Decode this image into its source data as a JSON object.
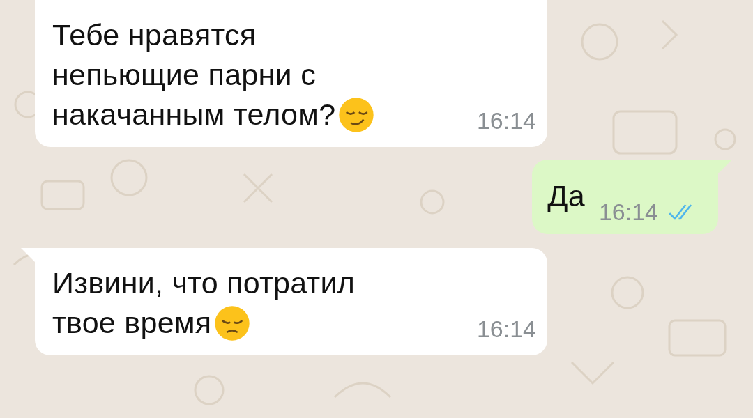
{
  "messages": [
    {
      "kind": "incoming",
      "lines": [
        "Тебе нравятся",
        "непьющие парни с",
        "накачанным телом?"
      ],
      "time": "16:14"
    },
    {
      "kind": "outgoing",
      "lines": [
        "Да"
      ],
      "time": "16:14",
      "read": true
    },
    {
      "kind": "incoming",
      "lines": [
        "Извини, что потратил",
        "твое время"
      ],
      "time": "16:14"
    }
  ]
}
